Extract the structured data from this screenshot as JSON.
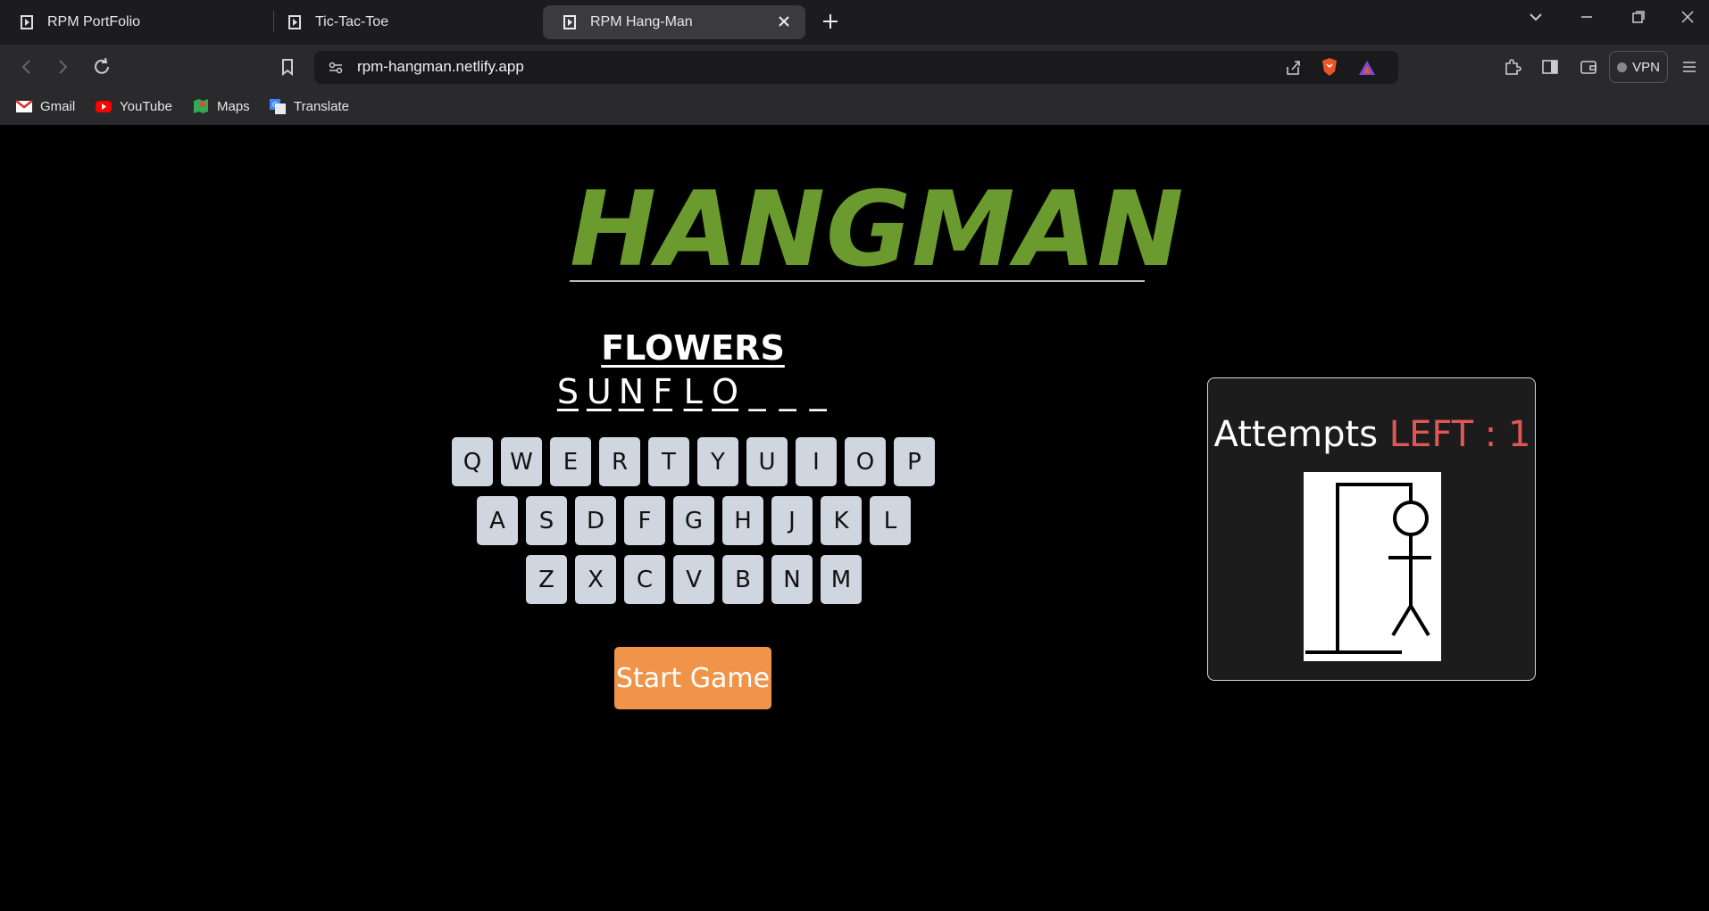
{
  "browser": {
    "tabs": [
      {
        "label": "RPM PortFolio"
      },
      {
        "label": "Tic-Tac-Toe"
      },
      {
        "label": "RPM Hang-Man"
      }
    ],
    "url": "rpm-hangman.netlify.app",
    "vpn_label": "VPN",
    "bookmarks": [
      {
        "label": "Gmail"
      },
      {
        "label": "YouTube"
      },
      {
        "label": "Maps"
      },
      {
        "label": "Translate"
      }
    ]
  },
  "game": {
    "title": "HANGMAN",
    "category": "FLOWERS",
    "word_letters": [
      "S",
      "U",
      "N",
      "F",
      "L",
      "O",
      "_",
      "_",
      "_"
    ],
    "keyboard_rows": [
      [
        "Q",
        "W",
        "E",
        "R",
        "T",
        "Y",
        "U",
        "I",
        "O",
        "P"
      ],
      [
        "A",
        "S",
        "D",
        "F",
        "G",
        "H",
        "J",
        "K",
        "L"
      ],
      [
        "Z",
        "X",
        "C",
        "V",
        "B",
        "N",
        "M"
      ]
    ],
    "start_button": "Start Game",
    "attempts_label": "Attempts",
    "attempts_left_label": "LEFT : 1",
    "colors": {
      "title": "#6b9a2e",
      "key_bg": "#cfd6e0",
      "start_bg": "#f0944a",
      "attempts_left": "#e15757"
    }
  }
}
